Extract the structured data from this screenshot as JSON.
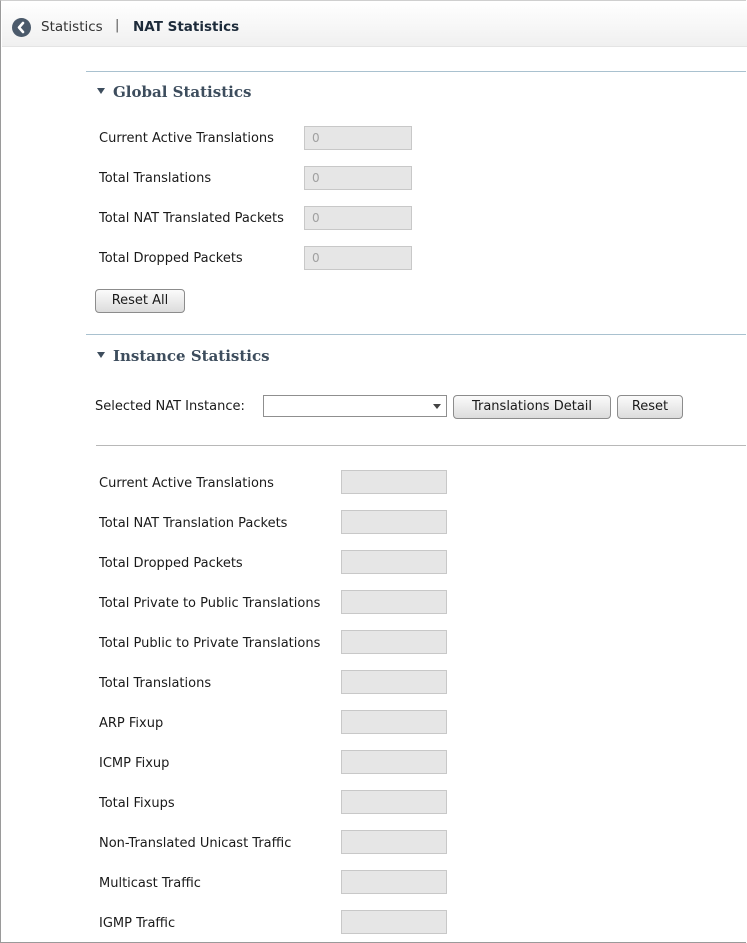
{
  "breadcrumb": {
    "parent": "Statistics",
    "separator": "|",
    "current": "NAT Statistics"
  },
  "global": {
    "title": "Global Statistics",
    "rows": [
      {
        "label": "Current Active Translations",
        "value": "0"
      },
      {
        "label": "Total Translations",
        "value": "0"
      },
      {
        "label": "Total NAT Translated Packets",
        "value": "0"
      },
      {
        "label": "Total Dropped Packets",
        "value": "0"
      }
    ],
    "reset_all_label": "Reset All"
  },
  "instance": {
    "title": "Instance Statistics",
    "selected_label": "Selected NAT Instance:",
    "selected_value": "",
    "translations_detail_label": "Translations Detail",
    "reset_label": "Reset",
    "rows": [
      {
        "label": "Current Active Translations",
        "value": ""
      },
      {
        "label": "Total NAT Translation Packets",
        "value": ""
      },
      {
        "label": "Total Dropped Packets",
        "value": ""
      },
      {
        "label": "Total Private to Public Translations",
        "value": ""
      },
      {
        "label": "Total Public to Private Translations",
        "value": ""
      },
      {
        "label": "Total Translations",
        "value": ""
      },
      {
        "label": "ARP Fixup",
        "value": ""
      },
      {
        "label": "ICMP Fixup",
        "value": ""
      },
      {
        "label": "Total Fixups",
        "value": ""
      },
      {
        "label": "Non-Translated Unicast Traffic",
        "value": ""
      },
      {
        "label": "Multicast Traffic",
        "value": ""
      },
      {
        "label": "IGMP Traffic",
        "value": ""
      }
    ]
  }
}
